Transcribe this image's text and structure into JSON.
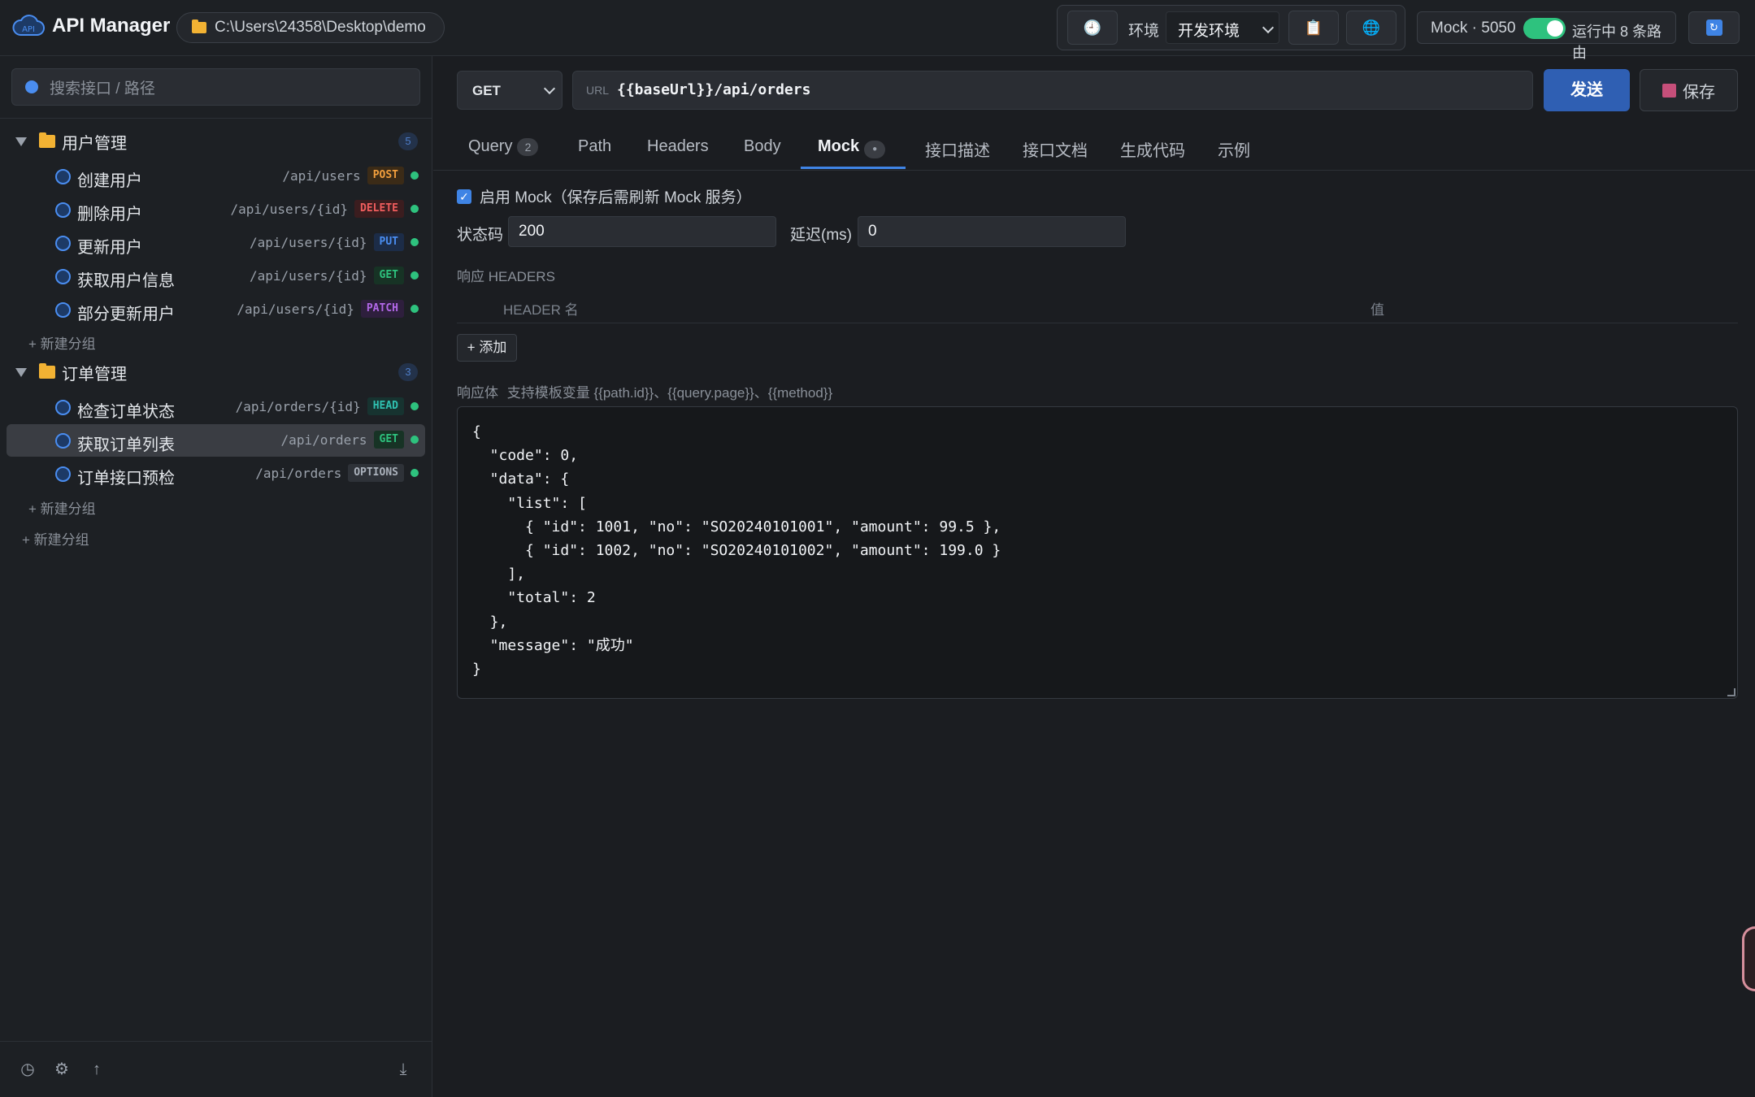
{
  "app": {
    "title": "API Manager",
    "project_path": "C:\\Users\\24358\\Desktop\\demo"
  },
  "topbar": {
    "history_icon": "clock-icon",
    "env_label": "环境",
    "env_value": "开发环境",
    "clipboard_icon": "clipboard-icon",
    "globe_icon": "globe-icon",
    "mock_label": "Mock · 5050",
    "mock_enabled": true,
    "mock_status": "运行中 8 条路由",
    "refresh_icon": "refresh-icon"
  },
  "sidebar": {
    "search_placeholder": "搜索接口 / 路径",
    "groups": [
      {
        "name": "用户管理",
        "count": "5",
        "items": [
          {
            "name": "创建用户",
            "path": "/api/users",
            "method": "POST",
            "color": "#f29f3d",
            "bg": "#3b2b17"
          },
          {
            "name": "删除用户",
            "path": "/api/users/{id}",
            "method": "DELETE",
            "color": "#f05d5d",
            "bg": "#3b1d1f"
          },
          {
            "name": "更新用户",
            "path": "/api/users/{id}",
            "method": "PUT",
            "color": "#4a8df0",
            "bg": "#1c2c47"
          },
          {
            "name": "获取用户信息",
            "path": "/api/users/{id}",
            "method": "GET",
            "color": "#2ec27e",
            "bg": "#173325"
          },
          {
            "name": "部分更新用户",
            "path": "/api/users/{id}",
            "method": "PATCH",
            "color": "#b268e8",
            "bg": "#2e1f3d"
          }
        ],
        "new_label": "+ 新建分组"
      },
      {
        "name": "订单管理",
        "count": "3",
        "items": [
          {
            "name": "检查订单状态",
            "path": "/api/orders/{id}",
            "method": "HEAD",
            "color": "#2fc0b0",
            "bg": "#173330"
          },
          {
            "name": "获取订单列表",
            "path": "/api/orders",
            "method": "GET",
            "color": "#2ec27e",
            "bg": "#173325"
          },
          {
            "name": "订单接口预检",
            "path": "/api/orders",
            "method": "OPTIONS",
            "color": "#aab1bb",
            "bg": "#2e3238"
          }
        ],
        "new_label": "+ 新建分组"
      }
    ],
    "root_new_label": "+ 新建分组",
    "footer_icons": [
      "history-icon",
      "settings-icon",
      "upload-icon",
      "download-icon"
    ]
  },
  "request": {
    "method": "GET",
    "url_label": "URL",
    "url": "{{baseUrl}}/api/orders",
    "send_label": "发送",
    "save_label": "保存"
  },
  "tabs": [
    {
      "label": "Query",
      "count": "2"
    },
    {
      "label": "Path"
    },
    {
      "label": "Headers"
    },
    {
      "label": "Body"
    },
    {
      "label": "Mock",
      "count": "●",
      "active": true
    },
    {
      "label": "接口描述"
    },
    {
      "label": "接口文档"
    },
    {
      "label": "生成代码"
    },
    {
      "label": "示例"
    }
  ],
  "mock": {
    "enable_label": "启用 Mock（保存后需刷新 Mock 服务）",
    "enabled": true,
    "status_label": "状态码",
    "status_value": "200",
    "delay_label": "延迟(ms)",
    "delay_value": "0",
    "headers_title": "响应 HEADERS",
    "header_name_col": "HEADER 名",
    "header_value_col": "值",
    "add_label": "+ 添加",
    "body_title": "响应体",
    "body_hint": "支持模板变量 {{path.id}}、{{query.page}}、{{method}}",
    "body": "{\n  \"code\": 0,\n  \"data\": {\n    \"list\": [\n      { \"id\": 1001, \"no\": \"SO20240101001\", \"amount\": 99.5 },\n      { \"id\": 1002, \"no\": \"SO20240101002\", \"amount\": 199.0 }\n    ],\n    \"total\": 2\n  },\n  \"message\": \"成功\"\n}"
  }
}
